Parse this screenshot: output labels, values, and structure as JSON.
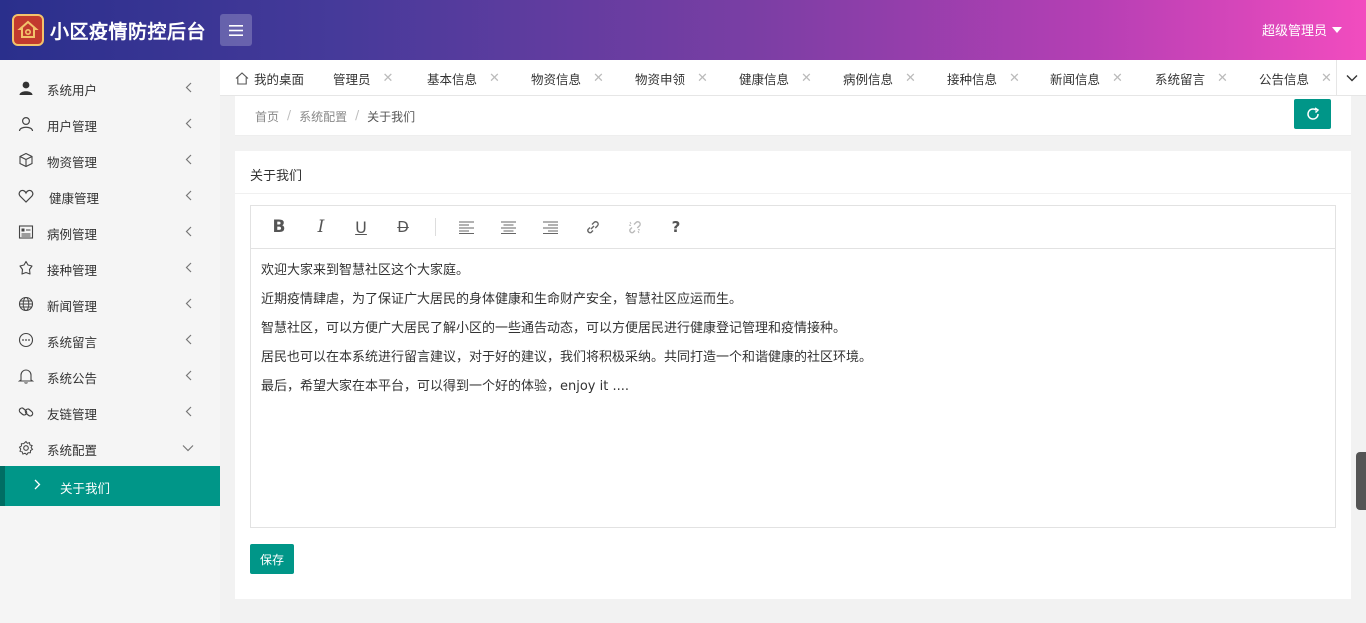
{
  "header": {
    "app_title": "小区疫情防控后台",
    "user_label": "超级管理员"
  },
  "sidebar": {
    "items": [
      {
        "label": "系统用户",
        "icon": "user-solid-icon"
      },
      {
        "label": "用户管理",
        "icon": "user-icon"
      },
      {
        "label": "物资管理",
        "icon": "cube-icon"
      },
      {
        "label": "健康管理",
        "icon": "heart-icon"
      },
      {
        "label": "病例管理",
        "icon": "form-icon"
      },
      {
        "label": "接种管理",
        "icon": "release-icon"
      },
      {
        "label": "新闻管理",
        "icon": "globe-icon"
      },
      {
        "label": "系统留言",
        "icon": "message-icon"
      },
      {
        "label": "系统公告",
        "icon": "bell-icon"
      },
      {
        "label": "友链管理",
        "icon": "link-icon"
      },
      {
        "label": "系统配置",
        "icon": "settings-icon"
      }
    ],
    "sub_item": "关于我们"
  },
  "tabs": {
    "items": [
      "我的桌面",
      "管理员",
      "基本信息",
      "物资信息",
      "物资申领",
      "健康信息",
      "病例信息",
      "接种信息",
      "新闻信息",
      "系统留言",
      "公告信息"
    ]
  },
  "breadcrumb": {
    "home": "首页",
    "section": "系统配置",
    "current": "关于我们"
  },
  "card": {
    "title": "关于我们",
    "content": [
      "欢迎大家来到智慧社区这个大家庭。",
      "近期疫情肆虐，为了保证广大居民的身体健康和生命财产安全，智慧社区应运而生。",
      "智慧社区，可以方便广大居民了解小区的一些通告动态，可以方便居民进行健康登记管理和疫情接种。",
      "居民也可以在本系统进行留言建议，对于好的建议，我们将积极采纳。共同打造一个和谐健康的社区环境。",
      "最后，希望大家在本平台，可以得到一个好的体验，enjoy it ...."
    ],
    "save_label": "保存"
  },
  "toolbar": {
    "bold": "B",
    "italic": "I",
    "underline": "U",
    "strike": "D",
    "help": "?"
  },
  "colors": {
    "accent": "#009688",
    "header_start": "#2a2f8c",
    "header_end": "#f24cbf"
  }
}
